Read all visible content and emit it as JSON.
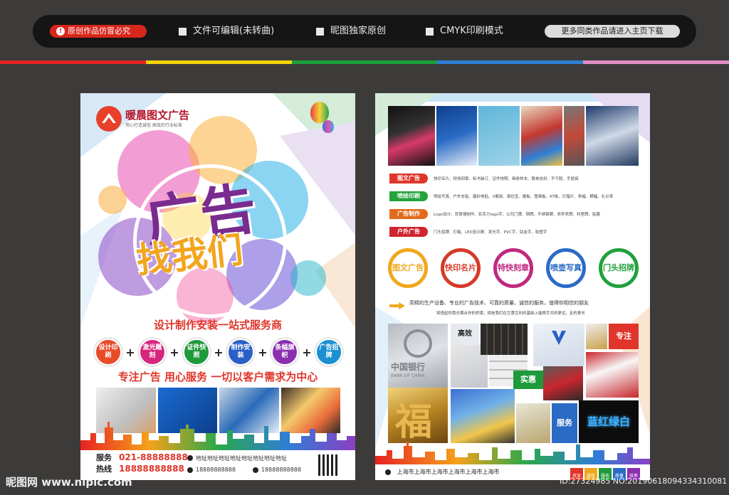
{
  "header": {
    "badge": "原创作品仿冒必究",
    "features": [
      "文件可编辑(未转曲)",
      "昵图独家原创",
      "CMYK印刷模式"
    ],
    "more_button": "更多同类作品请进入主页下载"
  },
  "stripe_colors": [
    "#e62222",
    "#f5d400",
    "#19a13a",
    "#2e7fd4",
    "#e38ec7"
  ],
  "left_flyer": {
    "brand_name": "暖晨图文广告",
    "brand_sub": "用心打造诚信  高效的行业标准",
    "headline_main": "广告",
    "headline_sub": "找我们",
    "slogan1": "设计制作安装一站式服务商",
    "services": [
      {
        "label": "设计印刷",
        "color": "#e84b28"
      },
      {
        "label": "激光雕刻",
        "color": "#d7267e"
      },
      {
        "label": "证件快照",
        "color": "#1e9a3b"
      },
      {
        "label": "制作安装",
        "color": "#2a5fc6"
      },
      {
        "label": "条幅旗帜",
        "color": "#8b2fb0"
      },
      {
        "label": "广告招牌",
        "color": "#1a8fd2"
      }
    ],
    "slogan2": "专注广告  用心服务  一切以客户需求为中心",
    "service_label": "服务",
    "service_number": "021-88888888",
    "hotline_label": "热线",
    "hotline_number": "18888888888",
    "address": "地址地址地址地址地址地址地址地址",
    "phone1": "18888888888",
    "phone2": "18888888888"
  },
  "right_flyer": {
    "categories": [
      {
        "tag": "图文广告",
        "color": "#e0352a",
        "desc": "快印名片、特快刻章、标书装订、证件快照、画册样本、联单信封、不干胶、手提袋"
      },
      {
        "tag": "喷绘印刷",
        "color": "#23a33c",
        "desc": "喷绘写真、户外车贴、磨砂地贴、X展架、易拉宝、展板、雪弗板、KT板、灯箱片、条幅、横幅、礼仪带"
      },
      {
        "tag": "广告制作",
        "color": "#e26a1c",
        "desc": "Logo设计、背景墙制作、亚克力logo字、公司门牌、铜牌、不锈钢牌、奖杯奖牌、科室牌、贴膜"
      },
      {
        "tag": "户外广告",
        "color": "#d0242f",
        "desc": "门头招牌、灯箱、LED显示屏、发光字、PVC字、钛金字、吸塑字"
      }
    ],
    "big_services": [
      {
        "label": "图文广告",
        "color": "#f0a81d"
      },
      {
        "label": "快印名片",
        "color": "#d63a2a"
      },
      {
        "label": "特快刻章",
        "color": "#c0287e"
      },
      {
        "label": "喷壶写真",
        "color": "#2a6bc6"
      },
      {
        "label": "门头招牌",
        "color": "#21a03c"
      }
    ],
    "quote_line1": "高精的生产设备、专业的广告技术、可靠的质量、诚信的服务，值得你相信的朋友",
    "quote_line2": "将搭起你我长期合作的桥梁，相信我们在互惠互利的基础上能携手共的更远，走的更长",
    "grid_labels": {
      "gaoxiao": "高效",
      "zhuanzhu": "专注",
      "shihui": "实惠",
      "fuwu": "服务",
      "neon": "蓝红绿白",
      "bank_cn": "中国银行",
      "bank_en": "BANK OF CHINA",
      "fu": "福"
    },
    "footer_address": "上海市上海市上海市上海市上海市上海市",
    "footer_tags": [
      "资深",
      "诚信",
      "服务",
      "质量",
      "效率"
    ]
  },
  "watermark": {
    "site": "昵图网 www.nipic.com",
    "id": "ID:27324985 NO:20190618094334310081"
  }
}
